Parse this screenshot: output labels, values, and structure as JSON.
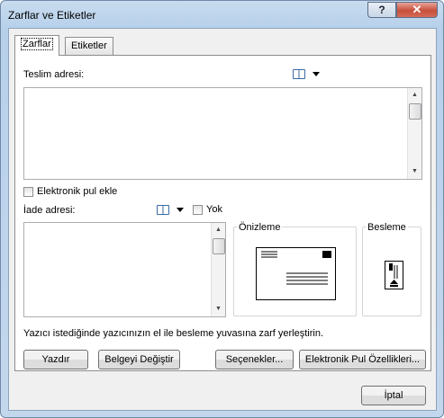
{
  "window": {
    "title": "Zarflar ve Etiketler",
    "help_glyph": "?",
    "close_glyph": "✕"
  },
  "tabs": [
    {
      "label": "Zarflar",
      "active": true
    },
    {
      "label": "Etiketler",
      "active": false
    }
  ],
  "delivery": {
    "label": "Teslim adresi:",
    "value": ""
  },
  "electronic_postage": {
    "label": "Elektronik pul ekle",
    "checked": false
  },
  "return": {
    "label": "İade adresi:",
    "value": "",
    "omit_label": "Yok",
    "omit_checked": false
  },
  "preview": {
    "label": "Önizleme"
  },
  "feed": {
    "label": "Besleme"
  },
  "instruction": "Yazıcı istediğinde yazıcınızın el ile besleme yuvasına zarf yerleştirin.",
  "buttons": {
    "print": "Yazdır",
    "change_document": "Belgeyi Değiştir",
    "options": "Seçenekler...",
    "postage_properties": "Elektronik Pul Özellikleri...",
    "cancel": "İptal"
  },
  "colors": {
    "title_bar": "#b7d0ea",
    "close_button": "#c74f3c",
    "panel": "#f0f0f0"
  },
  "icons": [
    "address-book-icon",
    "dropdown-arrow-icon",
    "envelope-preview-icon",
    "envelope-feed-icon",
    "scroll-up-arrow-icon",
    "scroll-down-arrow-icon"
  ]
}
